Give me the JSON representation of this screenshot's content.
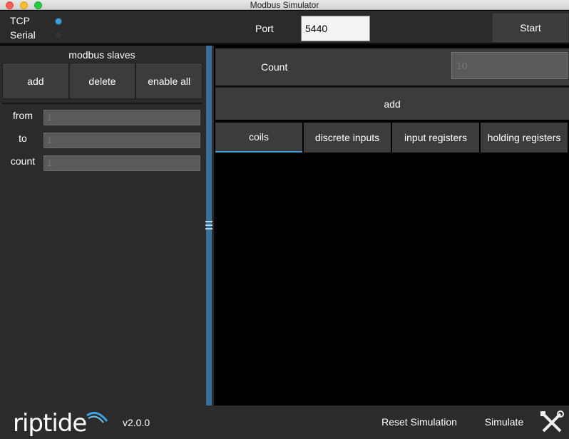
{
  "window": {
    "title": "Modbus Simulator"
  },
  "connection": {
    "modes": [
      {
        "label": "TCP",
        "selected": true
      },
      {
        "label": "Serial",
        "selected": false
      }
    ],
    "port_label": "Port",
    "port_value": "5440",
    "start_label": "Start"
  },
  "slaves_panel": {
    "title": "modbus slaves",
    "buttons": {
      "add": "add",
      "delete": "delete",
      "enable_all": "enable all"
    },
    "range": {
      "from_label": "from",
      "from_value": "1",
      "to_label": "to",
      "to_value": "1",
      "count_label": "count",
      "count_value": "1"
    }
  },
  "registers_panel": {
    "count_label": "Count",
    "count_placeholder": "10",
    "add_label": "add",
    "tabs": [
      {
        "label": "coils",
        "active": true
      },
      {
        "label": "discrete inputs",
        "active": false
      },
      {
        "label": "input registers",
        "active": false
      },
      {
        "label": "holding registers",
        "active": false
      }
    ]
  },
  "footer": {
    "logo_text": "riptide",
    "version": "v2.0.0",
    "reset_label": "Reset Simulation",
    "simulate_label": "Simulate",
    "settings_icon": "tools-icon"
  },
  "colors": {
    "accent": "#3ca0e0",
    "panel": "#2b2b2b",
    "button": "#3c3c3c"
  }
}
